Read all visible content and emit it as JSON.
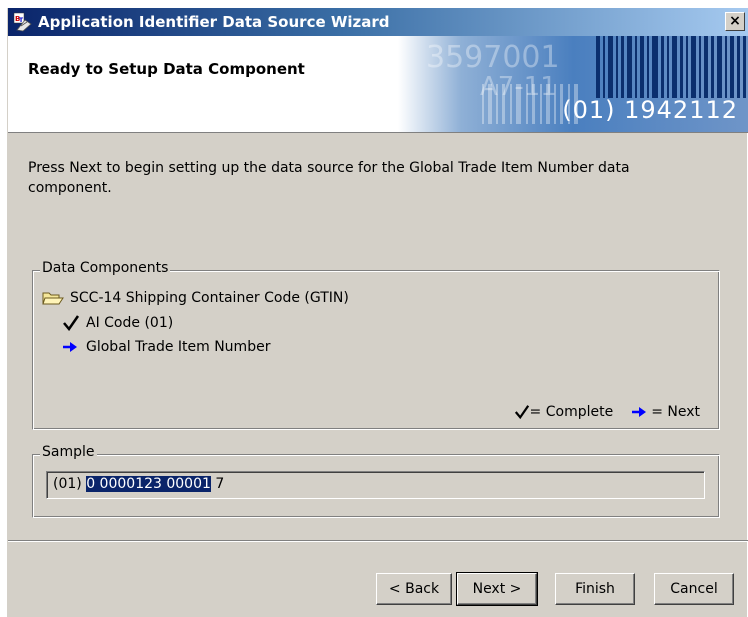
{
  "window": {
    "title": "Application Identifier Data Source Wizard",
    "close_glyph": "×"
  },
  "header": {
    "title": "Ready to Setup Data Component",
    "banner_text": "(01) 1942112",
    "banner_ghost_1": "3597001",
    "banner_ghost_2": "A7-11"
  },
  "instruction": "Press Next to begin setting up the data source for the Global Trade Item Number data component.",
  "data_components": {
    "label": "Data Components",
    "root": {
      "label": "SCC-14 Shipping Container Code (GTIN)",
      "icon": "folder-open-icon"
    },
    "children": [
      {
        "label": "AI Code (01)",
        "icon": "check-icon",
        "status": "complete"
      },
      {
        "label": "Global Trade Item Number",
        "icon": "arrow-right-icon",
        "status": "next"
      }
    ],
    "legend": {
      "complete_label": "= Complete",
      "next_label": "= Next"
    }
  },
  "sample": {
    "label": "Sample",
    "prefix": "(01) ",
    "highlighted": "0 0000123 00001",
    "suffix": " 7"
  },
  "buttons": {
    "back": "< Back",
    "next": "Next >",
    "finish": "Finish",
    "cancel": "Cancel"
  },
  "colors": {
    "titlebar_start": "#0a246a",
    "titlebar_end": "#a6caf0",
    "window_bg": "#d4d0c8",
    "selection": "#0a246a",
    "arrow": "#0000ff"
  }
}
